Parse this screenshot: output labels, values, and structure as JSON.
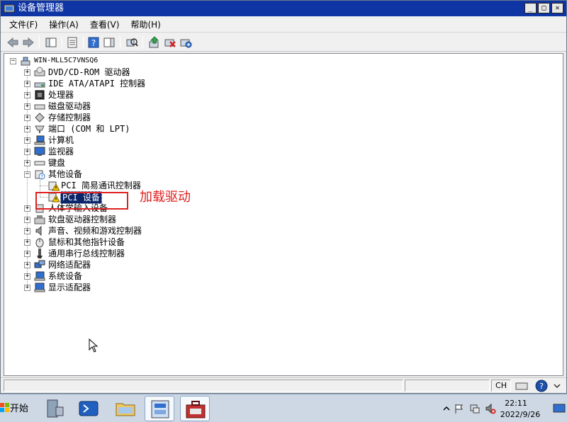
{
  "window": {
    "title": "设备管理器",
    "buttons": {
      "minimize": "_",
      "maximize": "□",
      "close": "✕"
    }
  },
  "menu": {
    "items": [
      {
        "label": "文件(F)"
      },
      {
        "label": "操作(A)"
      },
      {
        "label": "查看(V)"
      },
      {
        "label": "帮助(H)"
      }
    ]
  },
  "tree": {
    "root": "WIN-MLL5C7VNSQ6",
    "nodes": [
      {
        "label": "DVD/CD-ROM 驱动器",
        "icon": "dvd-drive-icon"
      },
      {
        "label": "IDE ATA/ATAPI 控制器",
        "icon": "ide-controller-icon"
      },
      {
        "label": "处理器",
        "icon": "processor-icon"
      },
      {
        "label": "磁盘驱动器",
        "icon": "disk-drive-icon"
      },
      {
        "label": "存储控制器",
        "icon": "storage-controller-icon"
      },
      {
        "label": "端口 (COM 和 LPT)",
        "icon": "port-icon"
      },
      {
        "label": "计算机",
        "icon": "computer-icon"
      },
      {
        "label": "监视器",
        "icon": "monitor-icon"
      },
      {
        "label": "键盘",
        "icon": "keyboard-icon"
      },
      {
        "label": "其他设备",
        "icon": "unknown-device-icon"
      },
      {
        "label": "PCI 简易通讯控制器",
        "icon": "warning-device-icon"
      },
      {
        "label": "PCI 设备",
        "icon": "warning-device-icon"
      },
      {
        "label": "人体学输入设备",
        "icon": "hid-icon"
      },
      {
        "label": "软盘驱动器控制器",
        "icon": "floppy-controller-icon"
      },
      {
        "label": "声音、视频和游戏控制器",
        "icon": "sound-icon"
      },
      {
        "label": "鼠标和其他指针设备",
        "icon": "mouse-icon"
      },
      {
        "label": "通用串行总线控制器",
        "icon": "usb-icon"
      },
      {
        "label": "网络适配器",
        "icon": "network-adapter-icon"
      },
      {
        "label": "系统设备",
        "icon": "system-device-icon"
      },
      {
        "label": "显示适配器",
        "icon": "display-adapter-icon"
      }
    ]
  },
  "annotation": {
    "text": "加载驱动",
    "color": "#e02020"
  },
  "statusbar": {
    "ime": "CH"
  },
  "taskbar": {
    "start_label": "开始",
    "clock_time": "22:11",
    "clock_date": "2022/9/26"
  },
  "colors": {
    "titlebar": "#0f35a4",
    "selection": "#0a246a",
    "annotation": "#e02020"
  }
}
